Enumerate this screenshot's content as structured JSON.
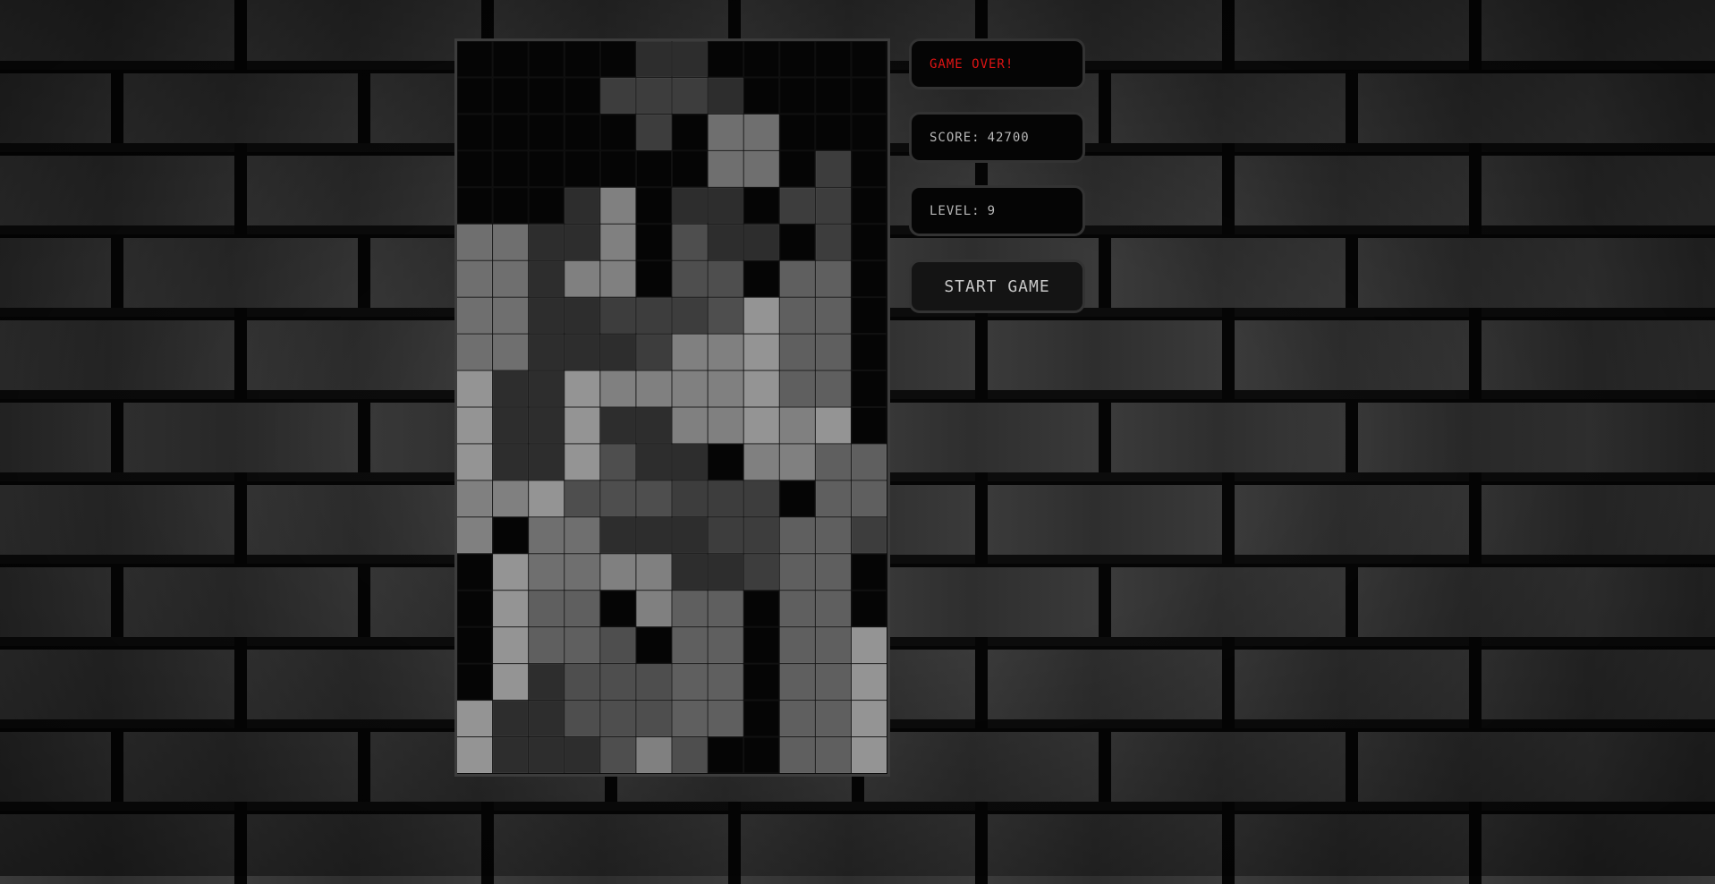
{
  "status": {
    "message": "GAME OVER!",
    "message_color": "#e01414"
  },
  "score": {
    "label": "SCORE:",
    "value": "42700"
  },
  "level": {
    "label": "LEVEL:",
    "value": "9"
  },
  "controls": {
    "start_label": "START GAME"
  },
  "board": {
    "cols": 12,
    "rows": 20,
    "shade_colors": [
      "#050505",
      "#2d2d2d",
      "#3d3d3d",
      "#4e4e4e",
      "#5f5f5f",
      "#6f6f6f",
      "#808080",
      "#949494"
    ],
    "cells": [
      [
        0,
        0,
        0,
        0,
        0,
        1,
        1,
        0,
        0,
        0,
        0,
        0
      ],
      [
        0,
        0,
        0,
        0,
        2,
        2,
        2,
        1,
        0,
        0,
        0,
        0
      ],
      [
        0,
        0,
        0,
        0,
        0,
        2,
        0,
        5,
        5,
        0,
        0,
        0
      ],
      [
        0,
        0,
        0,
        0,
        0,
        0,
        0,
        5,
        5,
        0,
        2,
        0
      ],
      [
        0,
        0,
        0,
        1,
        6,
        0,
        1,
        1,
        0,
        2,
        2,
        0
      ],
      [
        5,
        5,
        1,
        1,
        6,
        0,
        3,
        1,
        1,
        0,
        2,
        0
      ],
      [
        5,
        5,
        1,
        6,
        6,
        0,
        3,
        3,
        0,
        4,
        4,
        0
      ],
      [
        5,
        5,
        1,
        1,
        2,
        2,
        2,
        3,
        7,
        4,
        4,
        0
      ],
      [
        5,
        5,
        1,
        1,
        1,
        2,
        6,
        6,
        7,
        4,
        4,
        0
      ],
      [
        7,
        1,
        1,
        7,
        6,
        6,
        6,
        6,
        7,
        4,
        4,
        0
      ],
      [
        7,
        1,
        1,
        7,
        1,
        1,
        6,
        6,
        7,
        6,
        7,
        0
      ],
      [
        7,
        1,
        1,
        7,
        3,
        1,
        1,
        0,
        6,
        6,
        4,
        4
      ],
      [
        6,
        6,
        7,
        3,
        3,
        3,
        2,
        2,
        2,
        0,
        4,
        4
      ],
      [
        6,
        0,
        5,
        5,
        1,
        1,
        1,
        2,
        2,
        4,
        4,
        2
      ],
      [
        0,
        7,
        5,
        5,
        6,
        6,
        1,
        1,
        2,
        4,
        4,
        0
      ],
      [
        0,
        7,
        4,
        4,
        0,
        6,
        4,
        4,
        0,
        4,
        4,
        0
      ],
      [
        0,
        7,
        4,
        4,
        3,
        0,
        4,
        4,
        0,
        4,
        4,
        7
      ],
      [
        0,
        7,
        1,
        3,
        3,
        3,
        4,
        4,
        0,
        4,
        4,
        7
      ],
      [
        7,
        1,
        1,
        3,
        3,
        3,
        4,
        4,
        0,
        4,
        4,
        7
      ],
      [
        7,
        1,
        1,
        1,
        3,
        6,
        3,
        0,
        0,
        4,
        4,
        7
      ]
    ]
  }
}
